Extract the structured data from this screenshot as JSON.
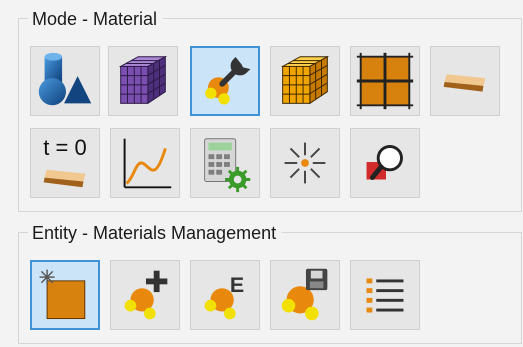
{
  "groups": [
    {
      "title": "Mode - Material",
      "tools": [
        {
          "icon": "primitive-shapes-icon"
        },
        {
          "icon": "purple-mesh-cube-icon"
        },
        {
          "icon": "material-wrench-icon",
          "selected": true
        },
        {
          "icon": "orange-mesh-cube-icon"
        },
        {
          "icon": "grid-surface-icon"
        },
        {
          "icon": "shell-section-icon"
        },
        {
          "icon": "initial-thickness-icon",
          "label": "t = 0"
        },
        {
          "icon": "curve-graph-icon"
        },
        {
          "icon": "calculator-settings-icon"
        },
        {
          "icon": "explode-star-icon"
        },
        {
          "icon": "inspect-magnifier-icon"
        }
      ]
    },
    {
      "title": "Entity - Materials Management",
      "tools": [
        {
          "icon": "new-material-icon",
          "selected": true
        },
        {
          "icon": "add-material-icon"
        },
        {
          "icon": "edit-material-icon",
          "label": "E"
        },
        {
          "icon": "save-material-icon"
        },
        {
          "icon": "material-list-icon"
        }
      ]
    }
  ],
  "colors": {
    "selected_border": "#3f93d4",
    "selected_fill": "#cce4f7",
    "tile_fill": "#e6e6e6",
    "orange": "#e8880c",
    "purple": "#7a4fb0",
    "blue": "#1e5fa8"
  }
}
